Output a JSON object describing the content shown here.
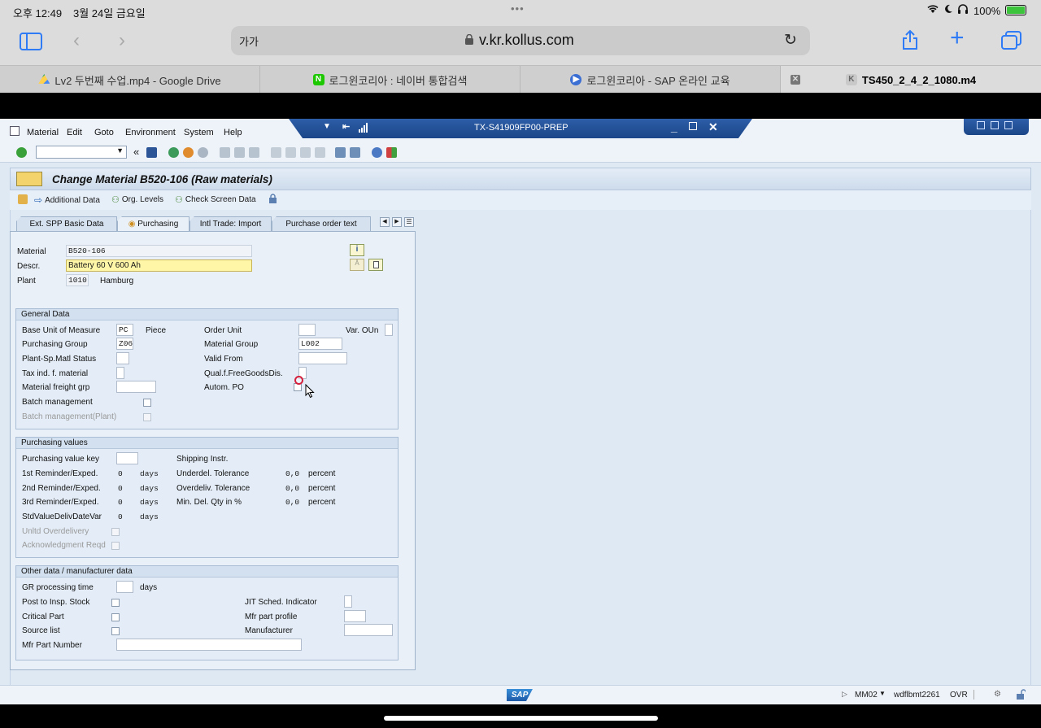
{
  "ios_status": {
    "time": "오후 12:49",
    "date": "3월 24일 금요일",
    "dots": "•••",
    "battery": "100%"
  },
  "browser": {
    "text_size": "가가",
    "url": "v.kr.kollus.com",
    "tabs": [
      {
        "label": "Lv2 두번째 수업.mp4 - Google Drive",
        "icon": "google-drive-icon"
      },
      {
        "label": "로그윈코리아 : 네이버 통합검색",
        "icon": "naver-icon",
        "badge": "N"
      },
      {
        "label": "로그윈코리아 - SAP 온라인 교육",
        "icon": "play-icon"
      },
      {
        "label": "TS450_2_4_2_1080.m4",
        "icon": "k-icon",
        "badge": "K"
      }
    ]
  },
  "sap": {
    "menu": [
      "Material",
      "Edit",
      "Goto",
      "Environment",
      "System",
      "Help"
    ],
    "window_title": "TX-S41909FP00-PREP",
    "screen_title": "Change Material B520-106 (Raw materials)",
    "app_toolbar": {
      "additional_data": "Additional Data",
      "org_levels": "Org. Levels",
      "check_screen_data": "Check Screen Data"
    },
    "tabs": [
      "Ext. SPP Basic Data",
      "Purchasing",
      "Intl Trade: Import",
      "Purchase order text"
    ],
    "active_tab": "Purchasing",
    "header_fields": {
      "material_label": "Material",
      "material": "B520-106",
      "descr_label": "Descr.",
      "descr": "Battery 60 V 600 Ah",
      "plant_label": "Plant",
      "plant": "1010",
      "plant_name": "Hamburg"
    },
    "general": {
      "title": "General Data",
      "base_uom_label": "Base Unit of Measure",
      "base_uom": "PC",
      "base_uom_text": "Piece",
      "order_unit_label": "Order Unit",
      "order_unit": "",
      "var_oun_label": "Var. OUn",
      "purch_group_label": "Purchasing Group",
      "purch_group": "Z06",
      "material_group_label": "Material Group",
      "material_group": "L002",
      "plant_status_label": "Plant-Sp.Matl Status",
      "valid_from_label": "Valid From",
      "tax_label": "Tax ind. f. material",
      "qual_label": "Qual.f.FreeGoodsDis.",
      "freight_label": "Material freight grp",
      "autom_po_label": "Autom. PO",
      "batch_label": "Batch management",
      "batch_plant_label": "Batch management(Plant)"
    },
    "purchasing": {
      "title": "Purchasing values",
      "value_key_label": "Purchasing value key",
      "shipping_label": "Shipping Instr.",
      "rem1_label": "1st Reminder/Exped.",
      "rem1": "0",
      "rem2_label": "2nd Reminder/Exped.",
      "rem2": "0",
      "rem3_label": "3rd Reminder/Exped.",
      "rem3": "0",
      "std_label": "StdValueDelivDateVar",
      "std": "0",
      "days": "days",
      "under_label": "Underdel. Tolerance",
      "under": "0,0",
      "over_label": "Overdeliv. Tolerance",
      "over": "0,0",
      "min_label": "Min. Del. Qty in %",
      "min": "0,0",
      "percent": "percent",
      "unltd_label": "Unltd Overdelivery",
      "ack_label": "Acknowledgment Reqd"
    },
    "other": {
      "title": "Other data / manufacturer data",
      "gr_label": "GR processing time",
      "days": "days",
      "post_label": "Post to Insp. Stock",
      "critical_label": "Critical Part",
      "source_label": "Source list",
      "mfr_num_label": "Mfr Part Number",
      "jit_label": "JIT Sched. Indicator",
      "mfr_profile_label": "Mfr part profile",
      "manufacturer_label": "Manufacturer"
    },
    "status": {
      "logo": "SAP",
      "tcode": "MM02",
      "server": "wdflbmt2261",
      "mode": "OVR"
    }
  }
}
